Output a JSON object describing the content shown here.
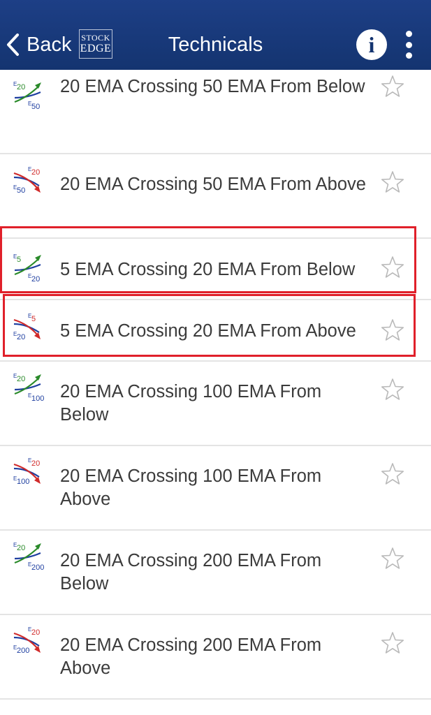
{
  "header": {
    "back_label": "Back",
    "logo_line1": "STOCK",
    "logo_line2": "EDGE",
    "title": "Technicals",
    "info_glyph": "i",
    "bg_color": "#143470"
  },
  "icons": {
    "back": "chevron-left-icon",
    "info": "info-icon",
    "more": "vertical-ellipsis-icon",
    "favorite": "star-outline-icon",
    "cross_up": "ema-crossover-up-icon",
    "cross_down": "ema-crossover-down-icon"
  },
  "colors": {
    "up": "#2a8a2a",
    "down": "#d02a2a",
    "base": "#1f3fa0",
    "highlight": "#e0202a"
  },
  "items": [
    {
      "label": "20 EMA Crossing 50 EMA From Below",
      "direction": "up",
      "ema_fast": "20",
      "ema_slow": "50",
      "highlighted": false
    },
    {
      "label": "20 EMA Crossing 50 EMA From Above",
      "direction": "down",
      "ema_fast": "20",
      "ema_slow": "50",
      "highlighted": false
    },
    {
      "label": "5 EMA Crossing 20 EMA From Below",
      "direction": "up",
      "ema_fast": "5",
      "ema_slow": "20",
      "highlighted": true
    },
    {
      "label": "5 EMA Crossing 20 EMA From Above",
      "direction": "down",
      "ema_fast": "5",
      "ema_slow": "20",
      "highlighted": true
    },
    {
      "label": "20 EMA Crossing 100 EMA From Below",
      "direction": "up",
      "ema_fast": "20",
      "ema_slow": "100",
      "highlighted": false
    },
    {
      "label": "20 EMA Crossing 100 EMA From Above",
      "direction": "down",
      "ema_fast": "20",
      "ema_slow": "100",
      "highlighted": false
    },
    {
      "label": "20 EMA Crossing 200 EMA From Below",
      "direction": "up",
      "ema_fast": "20",
      "ema_slow": "200",
      "highlighted": false
    },
    {
      "label": "20 EMA Crossing 200 EMA From Above",
      "direction": "down",
      "ema_fast": "20",
      "ema_slow": "200",
      "highlighted": false
    }
  ]
}
